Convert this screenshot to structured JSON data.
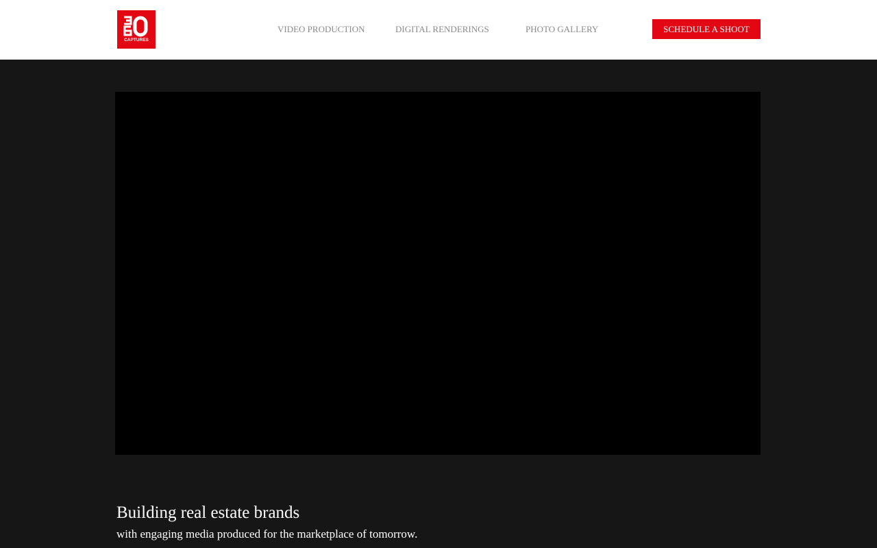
{
  "brand": {
    "logo_text": "360",
    "logo_subtext": "CAPTURES",
    "accent_color": "#e30613"
  },
  "nav": {
    "items": [
      {
        "label": "VIDEO PRODUCTION"
      },
      {
        "label": "DIGITAL RENDERINGS"
      },
      {
        "label": "PHOTO GALLERY"
      }
    ],
    "cta_label": "SCHEDULE A SHOOT"
  },
  "hero": {
    "background_color": "#161616",
    "video_color": "#000000",
    "headline": "Building real estate brands",
    "subheadline": "with engaging media produced for the marketplace of tomorrow."
  }
}
